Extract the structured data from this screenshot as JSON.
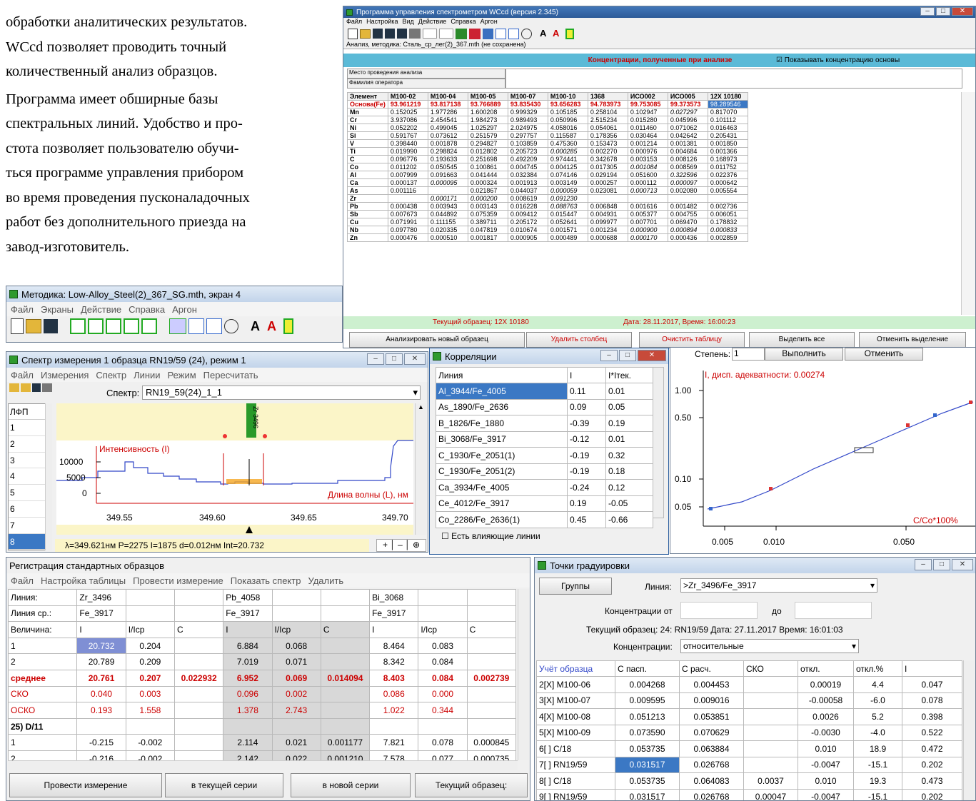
{
  "doc": {
    "lines": [
      "обработки аналитических результатов.",
      "WCcd позволяет проводить точный",
      "количественный анализ образцов.",
      "Программа имеет обширные базы",
      "спектральных линий. Удобство и про-",
      "стота позволяет пользователю обучи-",
      "ться программе управления прибором",
      "во время проведения пусконаладочных",
      "работ без дополнительного приезда на",
      "завод-изготовитель."
    ]
  },
  "main": {
    "title": "Программа управления спектрометром WCcd (версия 2.345)",
    "menu": [
      "Файл",
      "Настройка",
      "Вид",
      "Действие",
      "Справка",
      "Аргон"
    ],
    "status": "Анализ, методика: Сталь_ср_лег(2)_367.mth (не сохранена)",
    "banner": "Концентрации, полученные при анализе",
    "show_base": "Показывать концентрацию основы",
    "place": "Место проведения анализа",
    "operator": "Фамилия оператора",
    "headers": [
      "Элемент",
      "M100-02",
      "M100-04",
      "M100-05",
      "M100-07",
      "M100-10",
      "1368",
      "ИСО002",
      "ИСО005",
      "12X 10180"
    ],
    "base": [
      "Основа(Fe)",
      "93.961219",
      "93.817138",
      "93.766889",
      "93.835430",
      "93.656283",
      "94.783973",
      "99.753085",
      "99.373573",
      "98.289546"
    ],
    "rows": [
      [
        "Mn",
        "0.152025",
        "1.977286",
        "1.600208",
        "0.999329",
        "0.105185",
        "0.258104",
        "0.102947",
        "0.027297",
        "0.817070"
      ],
      [
        "Cr",
        "3.937086",
        "2.454541",
        "1.984273",
        "0.989493",
        "0.050996",
        "2.515234",
        "0.015280",
        "0.045996",
        "0.101112"
      ],
      [
        "Ni",
        "0.052202",
        "0.499045",
        "1.025297",
        "2.024975",
        "4.058016",
        "0.054061",
        "0.011460",
        "0.071062",
        "0.016463"
      ],
      [
        "Si",
        "0.591767",
        "0.073612",
        "0.251579",
        "0.297757",
        "0.115587",
        "0.178356",
        "0.030464",
        "0.042642",
        "0.205431"
      ],
      [
        "V",
        "0.398440",
        "0.001878",
        "0.294827",
        "0.103859",
        "0.475360",
        "0.153473",
        "0.001214",
        "0.001381",
        "0.001850"
      ],
      [
        "Ti",
        "0.019990",
        "0.298824",
        "0.012802",
        "0.205723",
        "0.000285",
        "0.002270",
        "0.000976",
        "0.004684",
        "0.001366"
      ],
      [
        "C",
        "0.096776",
        "0.193633",
        "0.251698",
        "0.492209",
        "0.974441",
        "0.342678",
        "0.003153",
        "0.008126",
        "0.168973"
      ],
      [
        "Co",
        "0.011202",
        "0.050545",
        "0.100861",
        "0.004745",
        "0.004125",
        "0.017305",
        "0.001084",
        "0.008569",
        "0.011752"
      ],
      [
        "Al",
        "0.007999",
        "0.091663",
        "0.041444",
        "0.032384",
        "0.074146",
        "0.029194",
        "0.051600",
        "0.322596",
        "0.022376"
      ],
      [
        "Ca",
        "0.000137",
        "0.000095",
        "0.000324",
        "0.001913",
        "0.003149",
        "0.000257",
        "0.000112",
        "0.000097",
        "0.000642"
      ],
      [
        "As",
        "0.001116",
        "",
        "0.021867",
        "0.044037",
        "0.000059",
        "0.023081",
        "0.000713",
        "0.002080",
        "0.005554"
      ],
      [
        "Zr",
        "",
        "0.000171",
        "0.000200",
        "0.008619",
        "0.091230",
        "",
        "",
        "",
        ""
      ],
      [
        "Pb",
        "0.000438",
        "0.003943",
        "0.003143",
        "0.016228",
        "0.088763",
        "0.006848",
        "0.001616",
        "0.001482",
        "0.002736"
      ],
      [
        "Sb",
        "0.007673",
        "0.044892",
        "0.075359",
        "0.009412",
        "0.015447",
        "0.004931",
        "0.005377",
        "0.004755",
        "0.006051"
      ],
      [
        "Cu",
        "0.071991",
        "0.111155",
        "0.389711",
        "0.205172",
        "0.052641",
        "0.099977",
        "0.007701",
        "0.069470",
        "0.178832"
      ],
      [
        "Nb",
        "0.097780",
        "0.020335",
        "0.047819",
        "0.010674",
        "0.001571",
        "0.001234",
        "0.000900",
        "0.000894",
        "0.000833"
      ],
      [
        "Zn",
        "0.000476",
        "0.000510",
        "0.001817",
        "0.000905",
        "0.000489",
        "0.000688",
        "0.000170",
        "0.000436",
        "0.002859"
      ]
    ],
    "current": "Текущий образец: 12X 10180",
    "date": "Дата: 28.11.2017, Время: 16:00:23",
    "buttons": [
      "Анализировать новый образец",
      "Удалить столбец",
      "Очистить таблицу",
      "Выделить все",
      "Отменить выделение"
    ]
  },
  "method": {
    "title": "Методика: Low-Alloy_Steel(2)_367_SG.mth, экран 4",
    "menu": [
      "Файл",
      "Экраны",
      "Действие",
      "Справка",
      "Аргон"
    ]
  },
  "spectrum": {
    "title": "Спектр измерения 1 образца RN19/59 (24), режим 1",
    "menu": [
      "Файл",
      "Измерения",
      "Спектр",
      "Линии",
      "Режим",
      "Пересчитать"
    ],
    "label": "Спектр:",
    "value": "RN19_59(24)_1_1",
    "list_head": "ЛФП",
    "list": [
      "1",
      "2",
      "3",
      "4",
      "5",
      "6",
      "7",
      "8"
    ],
    "zr_tag": "Zr 3496",
    "intensity": "Интенсивность (I)",
    "wavelength": "Длина волны (L), нм",
    "y_ticks": [
      "10000",
      "5000",
      "0"
    ],
    "x_ticks": [
      "349.55",
      "349.60",
      "349.65",
      "349.70"
    ],
    "status": "λ=349.621нм P=2275 I=1875 d=0.012нм Int=20.732"
  },
  "corr": {
    "title": "Корреляции",
    "headers": [
      "Линия",
      "I",
      "I*Iтек."
    ],
    "rows": [
      [
        "Al_3944/Fe_4005",
        "0.11",
        "0.01"
      ],
      [
        "As_1890/Fe_2636",
        "0.09",
        "0.05"
      ],
      [
        "B_1826/Fe_1880",
        "-0.39",
        "0.19"
      ],
      [
        "Bi_3068/Fe_3917",
        "-0.12",
        "0.01"
      ],
      [
        "C_1930/Fe_2051(1)",
        "-0.19",
        "0.32"
      ],
      [
        "C_1930/Fe_2051(2)",
        "-0.19",
        "0.18"
      ],
      [
        "Ca_3934/Fe_4005",
        "-0.24",
        "0.12"
      ],
      [
        "Ce_4012/Fe_3917",
        "0.19",
        "-0.05"
      ],
      [
        "Co_2286/Fe_2636(1)",
        "0.45",
        "-0.66"
      ]
    ],
    "checkbox": "Есть влияющие линии"
  },
  "calib": {
    "degree": "Степень:",
    "degree_val": "1",
    "run": "Выполнить",
    "cancel": "Отменить",
    "disp": "I, дисп. адекватности: 0.00274",
    "y_ticks": [
      "1.00",
      "0.50",
      "0.10",
      "0.05"
    ],
    "x_ticks": [
      "0.005",
      "0.010",
      "0.050"
    ],
    "xlabel": "C/Co*100%"
  },
  "reg": {
    "title": "Регистрация стандартных образцов",
    "menu": [
      "Файл",
      "Настройка таблицы",
      "Провести измерение",
      "Показать спектр",
      "Удалить"
    ],
    "rows": [
      [
        "Линия:",
        "Zr_3496",
        "",
        "",
        "Pb_4058",
        "",
        "",
        "Bi_3068",
        "",
        ""
      ],
      [
        "Линия ср.:",
        "Fe_3917",
        "",
        "",
        "Fe_3917",
        "",
        "",
        "Fe_3917",
        "",
        ""
      ],
      [
        "Величина:",
        "I",
        "I/Icp",
        "C",
        "I",
        "I/Icp",
        "C",
        "I",
        "I/Icp",
        "C"
      ],
      [
        "1",
        "20.732",
        "0.204",
        "",
        "6.884",
        "0.068",
        "",
        "8.464",
        "0.083",
        ""
      ],
      [
        "2",
        "20.789",
        "0.209",
        "",
        "7.019",
        "0.071",
        "",
        "8.342",
        "0.084",
        ""
      ],
      [
        "среднее",
        "20.761",
        "0.207",
        "0.022932",
        "6.952",
        "0.069",
        "0.014094",
        "8.403",
        "0.084",
        "0.002739"
      ],
      [
        "СКО",
        "0.040",
        "0.003",
        "",
        "0.096",
        "0.002",
        "",
        "0.086",
        "0.000",
        ""
      ],
      [
        "ОСКО",
        "0.193",
        "1.558",
        "",
        "1.378",
        "2.743",
        "",
        "1.022",
        "0.344",
        ""
      ],
      [
        "25) D/11",
        "",
        "",
        "",
        "",
        "",
        "",
        "",
        "",
        ""
      ],
      [
        "1",
        "-0.215",
        "-0.002",
        "",
        "2.114",
        "0.021",
        "0.001177",
        "7.821",
        "0.078",
        "0.000845"
      ],
      [
        "2",
        "-0.216",
        "-0.002",
        "",
        "2.142",
        "0.022",
        "0.001210",
        "7.578",
        "0.077",
        "0.000735"
      ]
    ],
    "buttons": [
      "Провести измерение",
      "в текущей серии",
      "в новой серии",
      "Текущий образец:"
    ]
  },
  "points": {
    "title": "Точки градуировки",
    "groups": "Группы",
    "line_label": "Линия:",
    "line_val": ">Zr_3496/Fe_3917",
    "conc_from": "Концентрации от",
    "to": "до",
    "current": "Текущий образец:  24: RN19/59 Дата: 27.11.2017 Время: 16:01:03",
    "conc_label": "Концентрации:",
    "conc_val": "относительные",
    "headers": [
      "Учёт образца",
      "С пасп.",
      "С расч.",
      "СКО",
      "откл.",
      "откл.%",
      "I"
    ],
    "rows": [
      [
        "2[X] M100-06",
        "0.004268",
        "0.004453",
        "",
        "0.00019",
        "4.4",
        "0.047"
      ],
      [
        "3[X] M100-07",
        "0.009595",
        "0.009016",
        "",
        "-0.00058",
        "-6.0",
        "0.078"
      ],
      [
        "4[X] M100-08",
        "0.051213",
        "0.053851",
        "",
        "0.0026",
        "5.2",
        "0.398"
      ],
      [
        "5[X] M100-09",
        "0.073590",
        "0.070629",
        "",
        "-0.0030",
        "-4.0",
        "0.522"
      ],
      [
        "6[ ] C/18",
        "0.053735",
        "0.063884",
        "",
        "0.010",
        "18.9",
        "0.472"
      ],
      [
        "7[ ] RN19/59",
        "0.031517",
        "0.026768",
        "",
        "-0.0047",
        "-15.1",
        "0.202"
      ],
      [
        "8[ ] C/18",
        "0.053735",
        "0.064083",
        "0.0037",
        "0.010",
        "19.3",
        "0.473"
      ],
      [
        "9[ ] RN19/59",
        "0.031517",
        "0.026768",
        "0.00047",
        "-0.0047",
        "-15.1",
        "0.202"
      ]
    ]
  }
}
